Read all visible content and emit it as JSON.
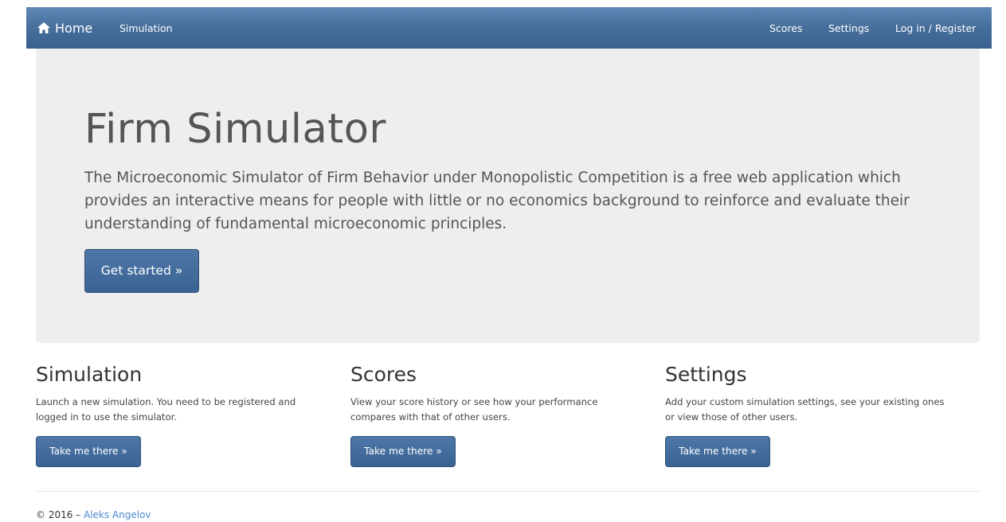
{
  "navbar": {
    "brand_icon": "home-icon",
    "brand_label": "Home",
    "left_links": [
      "Simulation"
    ],
    "right_links": [
      "Scores",
      "Settings",
      "Log in / Register"
    ]
  },
  "hero": {
    "title": "Firm Simulator",
    "lead": "The Microeconomic Simulator of Firm Behavior under Monopolistic Competition is a free web application which provides an interactive means for people with little or no economics background to reinforce and evaluate their understanding of fundamental microeconomic principles.",
    "button_label": "Get started »"
  },
  "columns": [
    {
      "heading": "Simulation",
      "text": "Launch a new simulation. You need to be registered and logged in to use the simulator.",
      "button_label": "Take me there »"
    },
    {
      "heading": "Scores",
      "text": "View your score history or see how your performance compares with that of other users.",
      "button_label": "Take me there »"
    },
    {
      "heading": "Settings",
      "text": "Add your custom simulation settings, see your existing ones or view those of other users.",
      "button_label": "Take me there »"
    }
  ],
  "footer": {
    "copyright": "© 2016 –",
    "author": "Aleks Angelov"
  },
  "colors": {
    "navbar": "#456d9a",
    "button": "#3f6898",
    "jumbotron": "#eeeeee",
    "footer_link": "#4a8ad0"
  }
}
